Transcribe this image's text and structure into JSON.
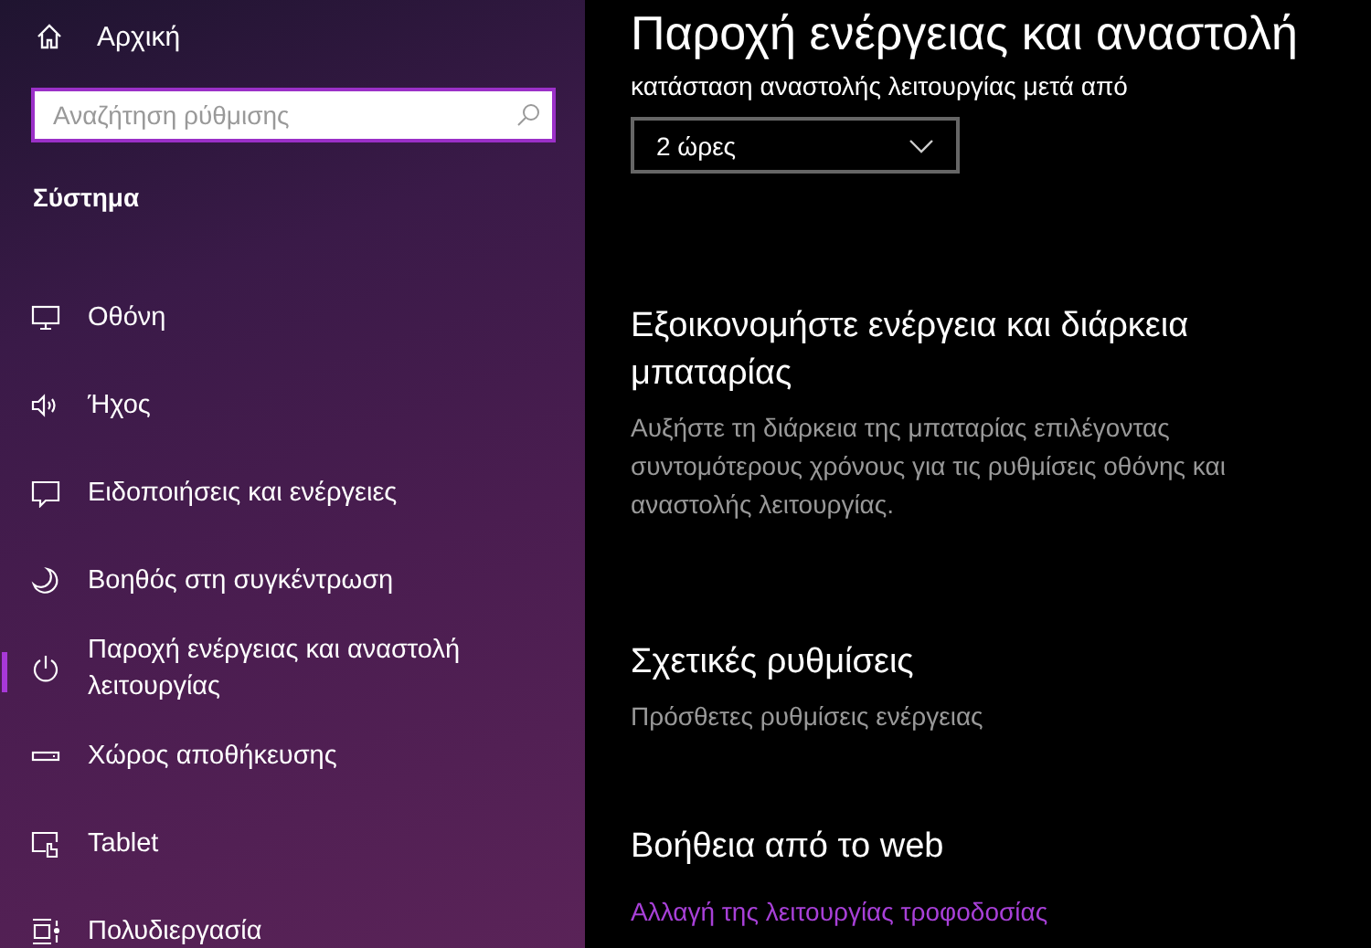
{
  "sidebar": {
    "home": "Αρχική",
    "search": {
      "placeholder": "Αναζήτηση ρύθμισης"
    },
    "section": "Σύστημα",
    "items": [
      {
        "label": "Οθόνη",
        "kind": "display",
        "selected": false
      },
      {
        "label": "Ήχος",
        "kind": "sound",
        "selected": false
      },
      {
        "label": "Ειδοποιήσεις και ενέργειες",
        "kind": "notifications",
        "selected": false
      },
      {
        "label": "Βοηθός στη συγκέντρωση",
        "kind": "moon",
        "selected": false
      },
      {
        "label": "Παροχή ενέργειας και αναστολή λειτουργίας",
        "kind": "power",
        "selected": true
      },
      {
        "label": "Χώρος αποθήκευσης",
        "kind": "storage",
        "selected": false
      },
      {
        "label": "Tablet",
        "kind": "tablet",
        "selected": false
      },
      {
        "label": "Πολυδιεργασία",
        "kind": "multitask",
        "selected": false
      }
    ]
  },
  "main": {
    "title": "Παροχή ενέργειας και αναστολή",
    "sleep_label": "κατάσταση αναστολής λειτουργίας μετά από",
    "sleep_value": "2 ώρες",
    "save": {
      "heading": "Εξοικονομήστε ενέργεια και διάρκεια μπαταρίας",
      "text": "Αυξήστε τη διάρκεια της μπαταρίας επιλέγοντας συντομότερους χρόνους για τις ρυθμίσεις οθόνης και αναστολής λειτουργίας."
    },
    "related": {
      "heading": "Σχετικές ρυθμίσεις",
      "link": "Πρόσθετες ρυθμίσεις ενέργειας"
    },
    "web_help": {
      "heading": "Βοήθεια από το web",
      "link": "Αλλαγή της λειτουργίας τροφοδοσίας"
    }
  }
}
